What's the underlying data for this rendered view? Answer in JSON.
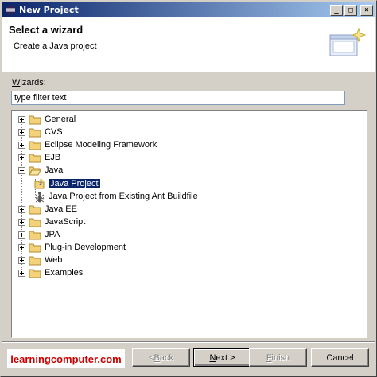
{
  "window": {
    "title": "New Project"
  },
  "header": {
    "title": "Select a wizard",
    "description": "Create a Java project"
  },
  "filter": {
    "label_prefix": "W",
    "label_rest": "izards:",
    "value": "type filter text"
  },
  "tree": {
    "items": [
      {
        "label": "General"
      },
      {
        "label": "CVS"
      },
      {
        "label": "Eclipse Modeling Framework"
      },
      {
        "label": "EJB"
      },
      {
        "label": "Java"
      },
      {
        "label": "Java Project"
      },
      {
        "label": "Java Project from Existing Ant Buildfile"
      },
      {
        "label": "Java EE"
      },
      {
        "label": "JavaScript"
      },
      {
        "label": "JPA"
      },
      {
        "label": "Plug-in Development"
      },
      {
        "label": "Web"
      },
      {
        "label": "Examples"
      }
    ]
  },
  "branding": {
    "text": "learningcomputer.com"
  },
  "buttons": {
    "back_prefix": "< ",
    "back_mnemonic": "B",
    "back_rest": "ack",
    "next_mnemonic": "N",
    "next_rest": "ext >",
    "finish_mnemonic": "F",
    "finish_rest": "inish",
    "cancel": "Cancel"
  }
}
